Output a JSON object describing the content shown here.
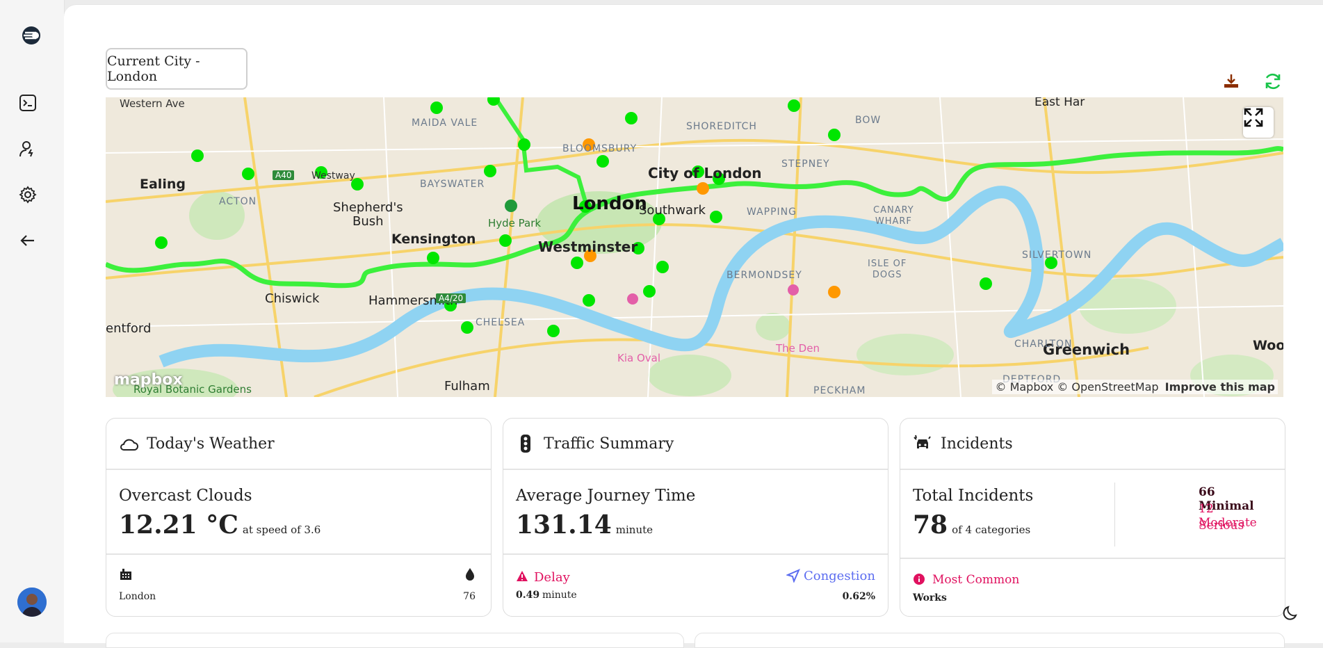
{
  "header": {
    "city_label": "Current City - London"
  },
  "sidebar": {
    "items": [
      "terminal-icon",
      "user-icon",
      "gear-icon",
      "back-arrow-icon"
    ]
  },
  "map": {
    "labels": {
      "western_ave": "Western Ave",
      "maida_vale": "MAIDA VALE",
      "bloomsbury": "BLOOMSBURY",
      "shoreditch": "SHOREDITCH",
      "bow": "BOW",
      "east_ham": "East Har",
      "ealing": "Ealing",
      "acton": "ACTON",
      "a40": "A40",
      "westway": "Westway",
      "bayswater": "BAYSWATER",
      "city_of_london": "City of London",
      "stepney": "STEPNEY",
      "shepherds_bush": "Shepherd's\nBush",
      "hyde_park": "Hyde Park",
      "london": "London",
      "southwark": "Southwark",
      "wapping": "WAPPING",
      "canary_wharf": "CANARY\nWHARF",
      "silvertown": "SILVERTOWN",
      "kensington": "Kensington",
      "westminster": "Westminster",
      "bermondsey": "BERMONDSEY",
      "isle_of_dogs": "ISLE OF\nDOGS",
      "chiswick": "Chiswick",
      "hammersmith": "Hammersmith",
      "a4_20": "A4/20",
      "chelsea": "CHELSEA",
      "brentford": "entford",
      "the_den": "The Den",
      "greenwich": "Greenwich",
      "charlton": "CHARLTON",
      "woolwich": "Wool",
      "kia_oval": "Kia Oval",
      "fulham": "Fulham",
      "royal_botanic": "Royal Botanic Gardens",
      "deptford": "DEPTFORD",
      "peckham": "PECKHAM"
    },
    "logo": "mapbox",
    "attribution": "© Mapbox © OpenStreetMap",
    "improve": "Improve this map"
  },
  "weather": {
    "title": "Today's Weather",
    "condition": "Overcast Clouds",
    "temp": "12.21 °C",
    "temp_suffix": "at speed of 3.6",
    "city": "London",
    "humidity": "76"
  },
  "traffic": {
    "title": "Traffic Summary",
    "avg_label": "Average Journey Time",
    "avg_value": "131.14",
    "avg_unit": "minute",
    "delay_label": "Delay",
    "delay_value": "0.49",
    "delay_unit": "minute",
    "congestion_label": "Congestion",
    "congestion_value": "0.62%"
  },
  "incidents": {
    "title": "Incidents",
    "total_label": "Total Incidents",
    "total_value": "78",
    "total_suffix": "of 4 categories",
    "minimal": "66 Minimal",
    "moderate": "12 Moderate",
    "serious": "Serious",
    "most_common_label": "Most Common",
    "most_common_value": "Works"
  },
  "colors": {
    "route": "#3cf03c",
    "point_ok": "#00e600",
    "point_warn": "#ff9800",
    "accent_red": "#e0115f",
    "accent_blue": "#5b6cf0"
  }
}
